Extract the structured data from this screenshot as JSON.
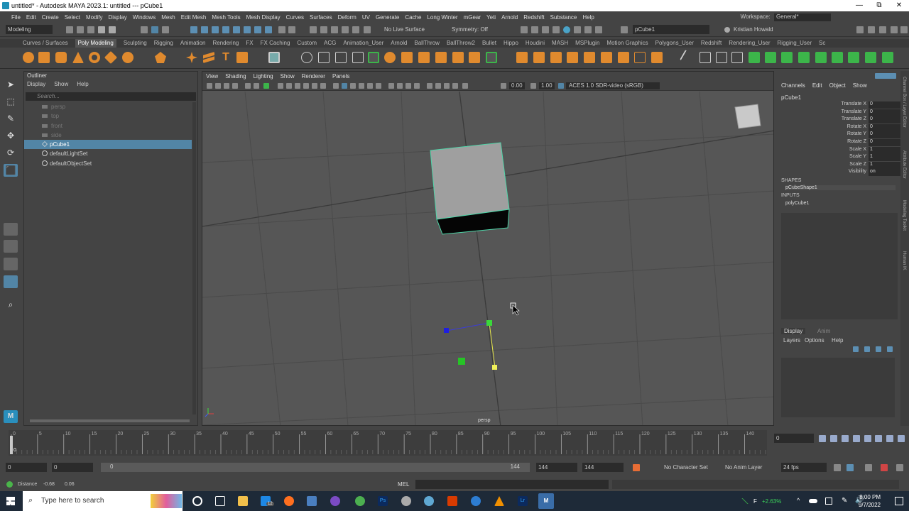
{
  "window": {
    "title": "untitled* - Autodesk MAYA 2023.1: untitled   ---   pCube1",
    "minimize": "—",
    "maximize": "⧉",
    "close": "✕"
  },
  "menu": [
    "File",
    "Edit",
    "Create",
    "Select",
    "Modify",
    "Display",
    "Windows",
    "Mesh",
    "Edit Mesh",
    "Mesh Tools",
    "Mesh Display",
    "Curves",
    "Surfaces",
    "Deform",
    "UV",
    "Generate",
    "Cache",
    "Long Winter",
    "mGear",
    "Yeti",
    "Arnold",
    "Redshift",
    "Substance",
    "Help"
  ],
  "workspace": {
    "label": "Workspace:",
    "value": "General*"
  },
  "status": {
    "mode": "Modeling",
    "live_surface": "No Live Surface",
    "symmetry": "Symmetry: Off",
    "object_field": "pCube1",
    "user": "Kristian Howald"
  },
  "shelf_tabs": [
    "Curves / Surfaces",
    "Poly Modeling",
    "Sculpting",
    "Rigging",
    "Animation",
    "Rendering",
    "FX",
    "FX Caching",
    "Custom",
    "ACG",
    "Animation_User",
    "Arnold",
    "BallThrow",
    "BallThrow2",
    "Bullet",
    "Hippo",
    "Houdini",
    "MASH",
    "MSPlugin",
    "Motion Graphics",
    "Polygons_User",
    "Redshift",
    "Rendering_User",
    "Rigging_User",
    "Sc"
  ],
  "shelf_active": "Poly Modeling",
  "outliner": {
    "title": "Outliner",
    "menu": [
      "Display",
      "Show",
      "Help"
    ],
    "search_placeholder": "Search...",
    "items": [
      {
        "label": "persp",
        "type": "camera"
      },
      {
        "label": "top",
        "type": "camera"
      },
      {
        "label": "front",
        "type": "camera"
      },
      {
        "label": "side",
        "type": "camera"
      },
      {
        "label": "pCube1",
        "type": "mesh",
        "selected": true
      },
      {
        "label": "defaultLightSet",
        "type": "set"
      },
      {
        "label": "defaultObjectSet",
        "type": "set"
      }
    ]
  },
  "viewport": {
    "menu": [
      "View",
      "Shading",
      "Lighting",
      "Show",
      "Renderer",
      "Panels"
    ],
    "near": "0.00",
    "far": "1.00",
    "colorspace": "ACES 1.0 SDR-video (sRGB)",
    "camera_label": "persp"
  },
  "channel_box": {
    "menu": [
      "Channels",
      "Edit",
      "Object",
      "Show"
    ],
    "object": "pCube1",
    "attributes": [
      {
        "name": "Translate X",
        "value": "0"
      },
      {
        "name": "Translate Y",
        "value": "0"
      },
      {
        "name": "Translate Z",
        "value": "0"
      },
      {
        "name": "Rotate X",
        "value": "0"
      },
      {
        "name": "Rotate Y",
        "value": "0"
      },
      {
        "name": "Rotate Z",
        "value": "0"
      },
      {
        "name": "Scale X",
        "value": "1"
      },
      {
        "name": "Scale Y",
        "value": "1"
      },
      {
        "name": "Scale Z",
        "value": "1"
      },
      {
        "name": "Visibility",
        "value": "on"
      }
    ],
    "shapes_label": "SHAPES",
    "shape": "pCubeShape1",
    "inputs_label": "INPUTS",
    "input": "polyCube1"
  },
  "side_tabs": [
    "Channel Box / Layer Editor",
    "Attribute Editor",
    "Modeling Toolkit",
    "Human IK"
  ],
  "layers": {
    "tabs": [
      "Display",
      "Anim"
    ],
    "menu": [
      "Layers",
      "Options",
      "Help"
    ]
  },
  "timeline": {
    "ticks": [
      "0",
      "5",
      "10",
      "15",
      "20",
      "25",
      "30",
      "35",
      "40",
      "45",
      "50",
      "55",
      "60",
      "65",
      "70",
      "75",
      "80",
      "85",
      "90",
      "95",
      "100",
      "105",
      "110",
      "115",
      "120",
      "125",
      "130",
      "135",
      "140"
    ],
    "current_frame": "0",
    "field_right": "0"
  },
  "range": {
    "start": "0",
    "inner_start": "0",
    "slider_start": "0",
    "slider_end": "144",
    "end_a": "144",
    "end_b": "144",
    "character_set": "No Character Set",
    "anim_layer": "No Anim Layer",
    "fps": "24 fps"
  },
  "cmd": {
    "distance_label": "Distance",
    "distance_a": "-0.68",
    "distance_b": "0.06",
    "lang": "MEL"
  },
  "taskbar": {
    "search": "Type here to search",
    "stock": "+2.63%",
    "stock_letter": "F",
    "time": "8:00 PM",
    "date": "9/7/2022",
    "badge": "12"
  }
}
